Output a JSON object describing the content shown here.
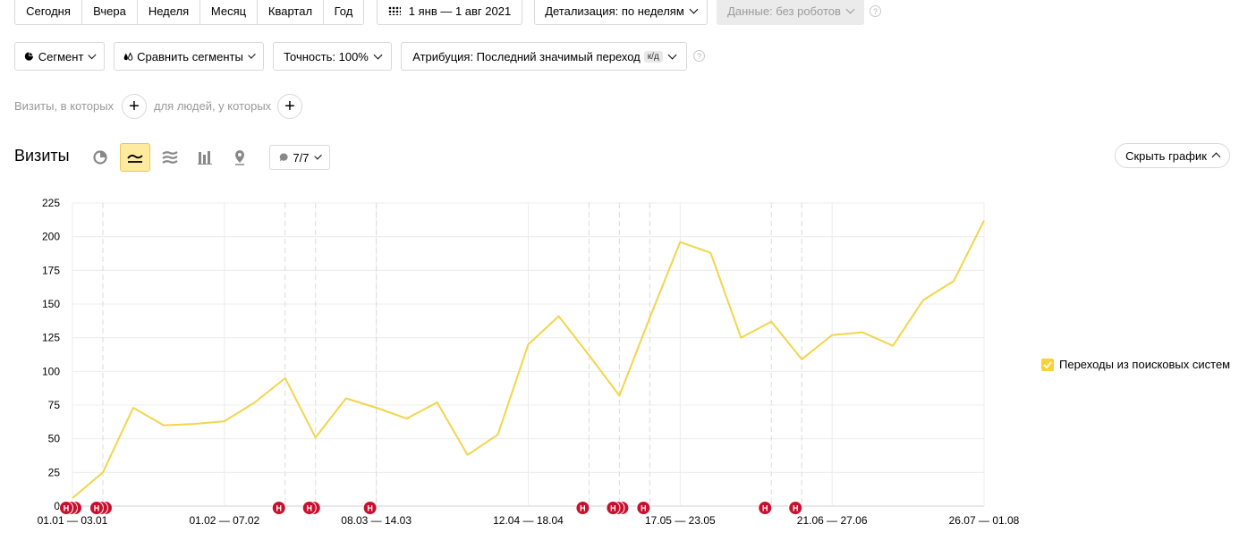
{
  "period_buttons": [
    "Сегодня",
    "Вчера",
    "Неделя",
    "Месяц",
    "Квартал",
    "Год"
  ],
  "date_range": "1 янв — 1 авг 2021",
  "detail_label": "Детализация: по неделям",
  "data_label": "Данные: без роботов",
  "segment_label": "Сегмент",
  "compare_label": "Сравнить сегменты",
  "accuracy_label": "Точность: 100%",
  "attribution_label": "Атрибуция: Последний значимый переход",
  "attribution_badge": "к/д",
  "filter_visits_label": "Визиты, в которых",
  "filter_people_label": "для людей, у которых",
  "section_title": "Визиты",
  "notes_count": "7/7",
  "hide_chart_label": "Скрыть график",
  "legend_label": "Переходы из поисковых систем",
  "colors": {
    "line": "#f2d54b",
    "note": "#c8102e",
    "active_bg": "#ffeba0"
  },
  "chart_data": {
    "type": "line",
    "ylim": [
      0,
      225
    ],
    "yticks": [
      "0",
      "25",
      "50",
      "75",
      "100",
      "125",
      "150",
      "175",
      "200",
      "225"
    ],
    "x_tick_labels": [
      "01.01 — 03.01",
      "01.02 — 07.02",
      "08.03 — 14.03",
      "12.04 — 18.04",
      "17.05 — 23.05",
      "21.06 — 27.06",
      "26.07 — 01.08"
    ],
    "x_tick_index": [
      0,
      5,
      10,
      15,
      20,
      25,
      30
    ],
    "series": [
      {
        "name": "Переходы из поисковых систем",
        "values": [
          6,
          25,
          73,
          60,
          61,
          63,
          77,
          95,
          51,
          80,
          73,
          65,
          77,
          38,
          53,
          120,
          141,
          112,
          82,
          140,
          196,
          188,
          125,
          137,
          109,
          127,
          129,
          119,
          153,
          167,
          212
        ]
      }
    ],
    "notes": [
      {
        "label": "Н",
        "index": 0,
        "count": 3
      },
      {
        "label": "Н",
        "index": 1,
        "count": 3
      },
      {
        "label": "Н",
        "index": 7,
        "count": 1
      },
      {
        "label": "Н",
        "index": 8,
        "count": 2
      },
      {
        "label": "Н",
        "index": 10,
        "count": 1
      },
      {
        "label": "Н",
        "index": 17,
        "count": 1
      },
      {
        "label": "Н",
        "index": 18,
        "count": 3
      },
      {
        "label": "Н",
        "index": 19,
        "count": 1
      },
      {
        "label": "Н",
        "index": 23,
        "count": 1
      },
      {
        "label": "Н",
        "index": 24,
        "count": 1
      }
    ]
  }
}
